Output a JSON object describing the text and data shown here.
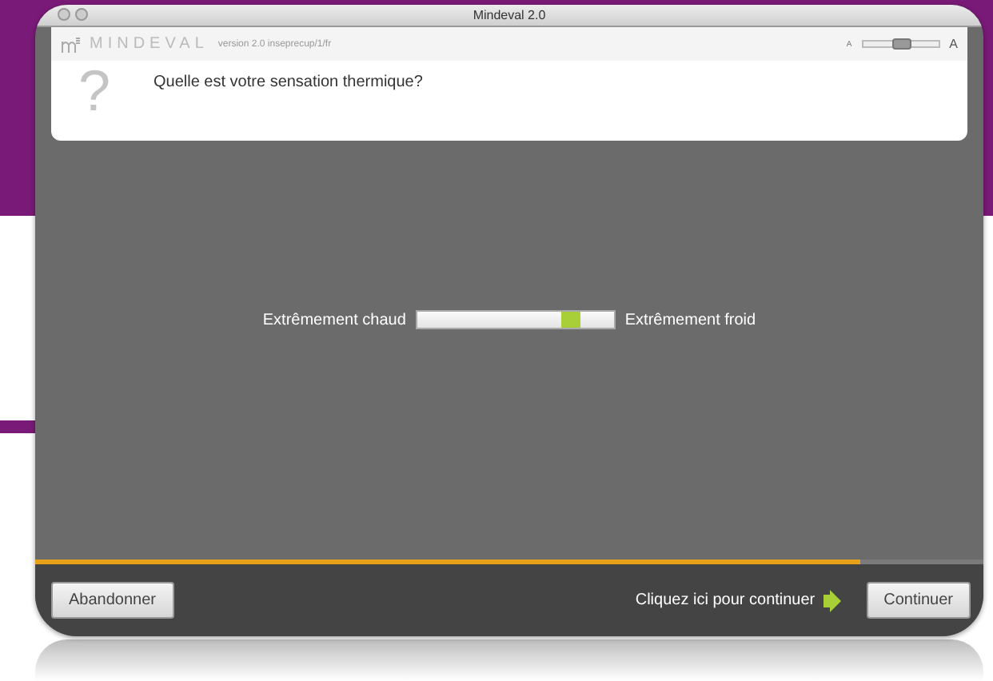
{
  "window": {
    "title": "Mindeval 2.0"
  },
  "header": {
    "logo": "MINDEVAL",
    "version": "version 2.0 inseprecup/1/fr",
    "font_size": {
      "small_label": "A",
      "large_label": "A",
      "level": 0.5
    }
  },
  "question": {
    "mark": "?",
    "text": "Quelle est votre sensation thermique?"
  },
  "scale": {
    "left_label": "Extrêmement chaud",
    "right_label": "Extrêmement froid",
    "level": 0.78
  },
  "progress": {
    "level": 0.87
  },
  "footer": {
    "abandon_button": "Abandonner",
    "hint": "Cliquez ici pour continuer",
    "continue_button": "Continuer"
  }
}
